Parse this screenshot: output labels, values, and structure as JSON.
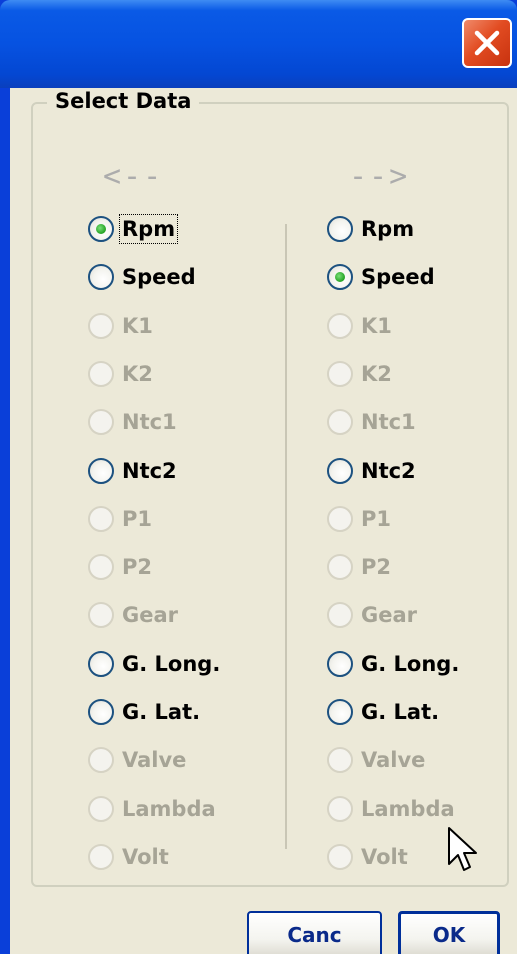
{
  "window": {
    "title": ""
  },
  "group": {
    "title": "Select Data"
  },
  "left": {
    "arrow": "<--",
    "options": [
      {
        "label": "Rpm",
        "enabled": true,
        "checked": true
      },
      {
        "label": "Speed",
        "enabled": true,
        "checked": false
      },
      {
        "label": "K1",
        "enabled": false,
        "checked": false
      },
      {
        "label": "K2",
        "enabled": false,
        "checked": false
      },
      {
        "label": "Ntc1",
        "enabled": false,
        "checked": false
      },
      {
        "label": "Ntc2",
        "enabled": true,
        "checked": false
      },
      {
        "label": "P1",
        "enabled": false,
        "checked": false
      },
      {
        "label": "P2",
        "enabled": false,
        "checked": false
      },
      {
        "label": "Gear",
        "enabled": false,
        "checked": false
      },
      {
        "label": "G. Long.",
        "enabled": true,
        "checked": false
      },
      {
        "label": "G. Lat.",
        "enabled": true,
        "checked": false
      },
      {
        "label": "Valve",
        "enabled": false,
        "checked": false
      },
      {
        "label": "Lambda",
        "enabled": false,
        "checked": false
      },
      {
        "label": "Volt",
        "enabled": false,
        "checked": false
      }
    ]
  },
  "right": {
    "arrow": "-->",
    "options": [
      {
        "label": "Rpm",
        "enabled": true,
        "checked": false
      },
      {
        "label": "Speed",
        "enabled": true,
        "checked": true
      },
      {
        "label": "K1",
        "enabled": false,
        "checked": false
      },
      {
        "label": "K2",
        "enabled": false,
        "checked": false
      },
      {
        "label": "Ntc1",
        "enabled": false,
        "checked": false
      },
      {
        "label": "Ntc2",
        "enabled": true,
        "checked": false
      },
      {
        "label": "P1",
        "enabled": false,
        "checked": false
      },
      {
        "label": "P2",
        "enabled": false,
        "checked": false
      },
      {
        "label": "Gear",
        "enabled": false,
        "checked": false
      },
      {
        "label": "G. Long.",
        "enabled": true,
        "checked": false
      },
      {
        "label": "G. Lat.",
        "enabled": true,
        "checked": false
      },
      {
        "label": "Valve",
        "enabled": false,
        "checked": false
      },
      {
        "label": "Lambda",
        "enabled": false,
        "checked": false
      },
      {
        "label": "Volt",
        "enabled": false,
        "checked": false
      }
    ]
  },
  "buttons": {
    "cancel": "Canc",
    "ok": "OK"
  },
  "icons": {
    "close": "close-icon",
    "cursor": "mouse-pointer-icon",
    "checked_dot": "radio-checked-dot"
  },
  "colors": {
    "title_bar": "#0652e1",
    "window_bg": "#ece9d8",
    "close_button": "#e24c22",
    "radio_check": "#21a121",
    "disabled_text": "#a6a496",
    "button_text": "#0a2a8a"
  }
}
